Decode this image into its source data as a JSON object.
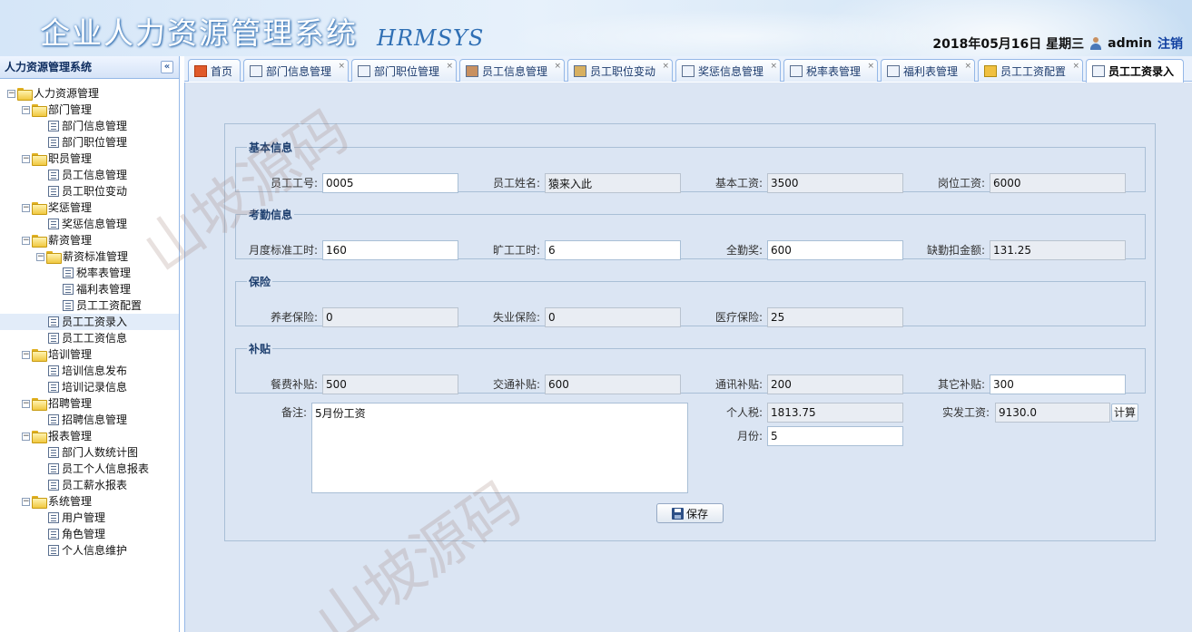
{
  "header": {
    "title": "企业人力资源管理系统",
    "subtitle": "HRMSYS",
    "date": "2018年05月16日 星期三",
    "user": "admin",
    "logout": "注销"
  },
  "sidebar": {
    "title": "人力资源管理系统",
    "collapse": "«",
    "tree": {
      "root": "人力资源管理",
      "dept": "部门管理",
      "dept_info": "部门信息管理",
      "dept_pos": "部门职位管理",
      "staff": "职员管理",
      "staff_info": "员工信息管理",
      "staff_change": "员工职位变动",
      "reward": "奖惩管理",
      "reward_info": "奖惩信息管理",
      "salary": "薪资管理",
      "salary_std": "薪资标准管理",
      "tax": "税率表管理",
      "welfare": "福利表管理",
      "salary_config": "员工工资配置",
      "salary_entry": "员工工资录入",
      "salary_info": "员工工资信息",
      "training": "培训管理",
      "training_pub": "培训信息发布",
      "training_rec": "培训记录信息",
      "recruit": "招聘管理",
      "recruit_info": "招聘信息管理",
      "report": "报表管理",
      "report_dept": "部门人数统计图",
      "report_person": "员工个人信息报表",
      "report_salary": "员工薪水报表",
      "system": "系统管理",
      "sys_user": "用户管理",
      "sys_role": "角色管理",
      "sys_profile": "个人信息维护"
    }
  },
  "tabs": [
    "首页",
    "部门信息管理",
    "部门职位管理",
    "员工信息管理",
    "员工职位变动",
    "奖惩信息管理",
    "税率表管理",
    "福利表管理",
    "员工工资配置",
    "员工工资录入"
  ],
  "tab_close": "×",
  "form": {
    "basic": {
      "legend": "基本信息",
      "emp_no_label": "员工工号:",
      "emp_no": "0005",
      "name_label": "员工姓名:",
      "name": "猿来入此",
      "base_label": "基本工资:",
      "base": "3500",
      "post_label": "岗位工资:",
      "post": "6000"
    },
    "attendance": {
      "legend": "考勤信息",
      "std_hours_label": "月度标准工时:",
      "std_hours": "160",
      "absent_label": "旷工工时:",
      "absent": "6",
      "bonus_label": "全勤奖:",
      "bonus": "600",
      "deduct_label": "缺勤扣金额:",
      "deduct": "131.25"
    },
    "insurance": {
      "legend": "保险",
      "pension_label": "养老保险:",
      "pension": "0",
      "unemploy_label": "失业保险:",
      "unemploy": "0",
      "medical_label": "医疗保险:",
      "medical": "25"
    },
    "allowance": {
      "legend": "补贴",
      "meal_label": "餐费补贴:",
      "meal": "500",
      "traffic_label": "交通补贴:",
      "traffic": "600",
      "comm_label": "通讯补贴:",
      "comm": "200",
      "other_label": "其它补贴:",
      "other": "300"
    },
    "remark_label": "备注:",
    "remark": "5月份工资",
    "tax_label": "个人税:",
    "tax": "1813.75",
    "month_label": "月份:",
    "month": "5",
    "net_label": "实发工资:",
    "net": "9130.0",
    "calc": "计算",
    "save": "保存"
  },
  "watermark": "山坡源码"
}
